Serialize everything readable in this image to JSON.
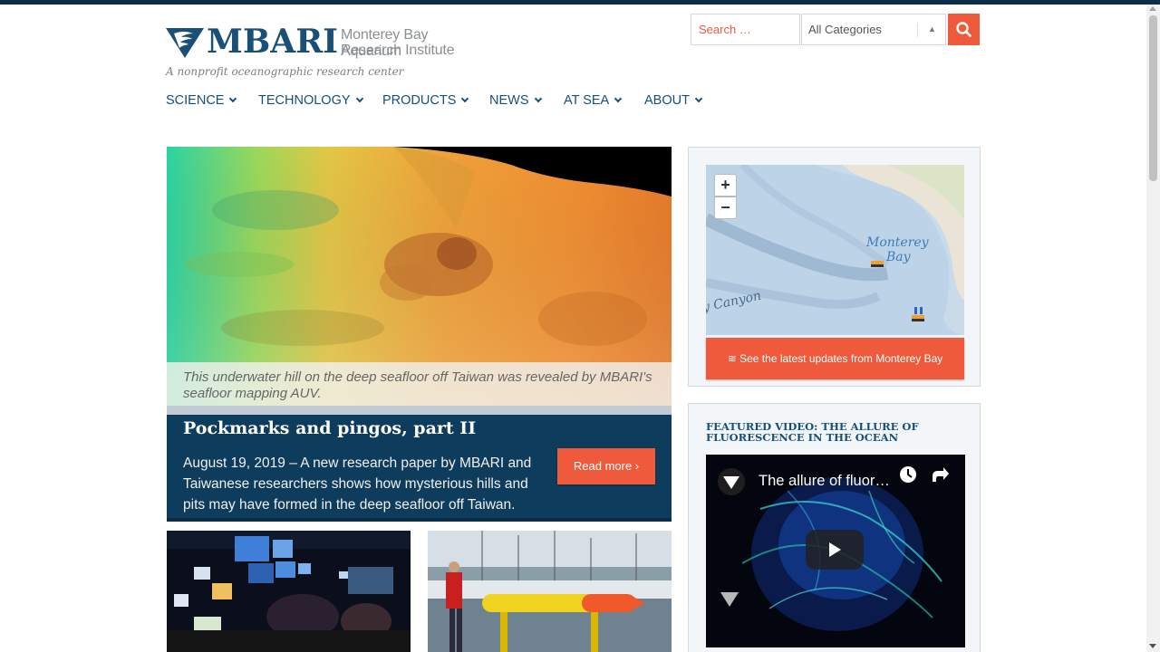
{
  "site": {
    "logo_text": "MBARI",
    "logo_sub1": "Monterey Bay Aquarium",
    "logo_sub2": "Research Institute",
    "tagline": "A nonprofit oceanographic research center"
  },
  "search": {
    "placeholder": "Search …",
    "category": "All Categories"
  },
  "nav": [
    {
      "label": "SCIENCE"
    },
    {
      "label": "TECHNOLOGY"
    },
    {
      "label": "PRODUCTS"
    },
    {
      "label": "NEWS"
    },
    {
      "label": "AT SEA"
    },
    {
      "label": "ABOUT"
    }
  ],
  "hero": {
    "caption": "This underwater hill on the deep seafloor off Taiwan was revealed by MBARI's seafloor mapping AUV.",
    "title": "Pockmarks and pingos, part II",
    "text": "August 19, 2019 – A new research paper by MBARI and Taiwanese researchers shows how mysterious hills and pits may have formed in the deep seafloor off Taiwan.",
    "read_more": "Read more ›"
  },
  "map": {
    "zoom_in": "+",
    "zoom_out": "−",
    "label_monterey": "Monterey",
    "label_bay": "Bay",
    "label_canyon": "y Canyon",
    "button": "≋ See the latest updates from Monterey Bay"
  },
  "video": {
    "heading": "FEATURED VIDEO: THE ALLURE OF FLUORESCENCE IN THE OCEAN",
    "title": "The allure of fluorescence in the ocean"
  },
  "colors": {
    "brand_blue": "#1a4f76",
    "accent": "#ef5a3c",
    "feature_bg": "#0e3c5c"
  }
}
